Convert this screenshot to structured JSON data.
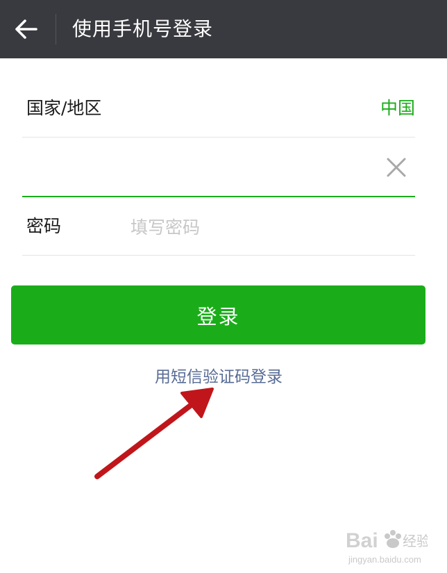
{
  "header": {
    "back_icon": "arrow-left-icon",
    "title": "使用手机号登录"
  },
  "form": {
    "region_label": "国家/地区",
    "region_value": "中国",
    "phone_value": "",
    "clear_icon": "close-icon",
    "password_label": "密码",
    "password_placeholder": "填写密码",
    "login_label": "登录",
    "sms_link": "用短信验证码登录"
  },
  "watermark": {
    "brand": "Baidu经验",
    "url": "jingyan.baidu.com"
  },
  "colors": {
    "header_bg": "#393a3f",
    "accent_green": "#1aad19",
    "link_blue": "#576b95",
    "annotation_red": "#c0161b"
  }
}
